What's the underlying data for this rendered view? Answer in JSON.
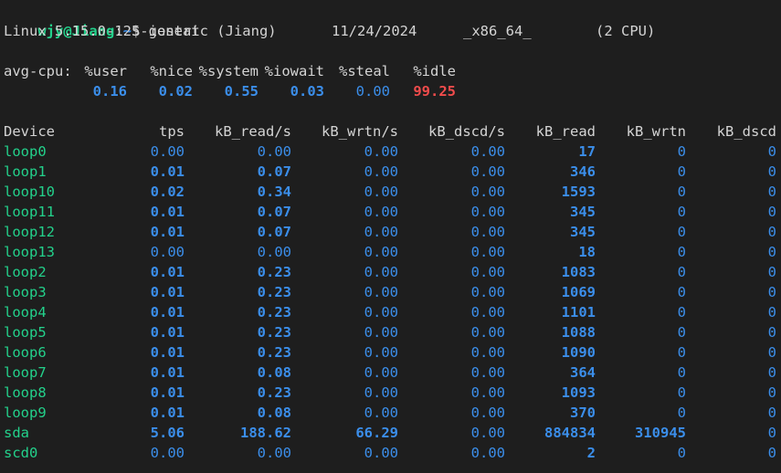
{
  "prompt": {
    "user_host": "wjy@Jiang",
    "path": "~",
    "symbol": "$",
    "command": "iostat"
  },
  "sysinfo": {
    "kernel": "Linux 5.15.0-125-generic (Jiang)",
    "date": "11/24/2024",
    "arch": "_x86_64_",
    "cpus": "(2 CPU)"
  },
  "cpu": {
    "label": "avg-cpu:",
    "headers": [
      "%user",
      "%nice",
      "%system",
      "%iowait",
      "%steal",
      "%idle"
    ],
    "values": [
      "0.16",
      "0.02",
      "0.55",
      "0.03",
      "0.00",
      "99.25"
    ]
  },
  "device_table": {
    "headers": [
      "Device",
      "tps",
      "kB_read/s",
      "kB_wrtn/s",
      "kB_dscd/s",
      "kB_read",
      "kB_wrtn",
      "kB_dscd"
    ],
    "rows": [
      [
        "loop0",
        "0.00",
        "0.00",
        "0.00",
        "0.00",
        "17",
        "0",
        "0"
      ],
      [
        "loop1",
        "0.01",
        "0.07",
        "0.00",
        "0.00",
        "346",
        "0",
        "0"
      ],
      [
        "loop10",
        "0.02",
        "0.34",
        "0.00",
        "0.00",
        "1593",
        "0",
        "0"
      ],
      [
        "loop11",
        "0.01",
        "0.07",
        "0.00",
        "0.00",
        "345",
        "0",
        "0"
      ],
      [
        "loop12",
        "0.01",
        "0.07",
        "0.00",
        "0.00",
        "345",
        "0",
        "0"
      ],
      [
        "loop13",
        "0.00",
        "0.00",
        "0.00",
        "0.00",
        "18",
        "0",
        "0"
      ],
      [
        "loop2",
        "0.01",
        "0.23",
        "0.00",
        "0.00",
        "1083",
        "0",
        "0"
      ],
      [
        "loop3",
        "0.01",
        "0.23",
        "0.00",
        "0.00",
        "1069",
        "0",
        "0"
      ],
      [
        "loop4",
        "0.01",
        "0.23",
        "0.00",
        "0.00",
        "1101",
        "0",
        "0"
      ],
      [
        "loop5",
        "0.01",
        "0.23",
        "0.00",
        "0.00",
        "1088",
        "0",
        "0"
      ],
      [
        "loop6",
        "0.01",
        "0.23",
        "0.00",
        "0.00",
        "1090",
        "0",
        "0"
      ],
      [
        "loop7",
        "0.01",
        "0.08",
        "0.00",
        "0.00",
        "364",
        "0",
        "0"
      ],
      [
        "loop8",
        "0.01",
        "0.23",
        "0.00",
        "0.00",
        "1093",
        "0",
        "0"
      ],
      [
        "loop9",
        "0.01",
        "0.08",
        "0.00",
        "0.00",
        "370",
        "0",
        "0"
      ],
      [
        "sda",
        "5.06",
        "188.62",
        "66.29",
        "0.00",
        "884834",
        "310945",
        "0"
      ],
      [
        "scd0",
        "0.00",
        "0.00",
        "0.00",
        "0.00",
        "2",
        "0",
        "0"
      ]
    ]
  },
  "colors": {
    "background": "#1e1e1e",
    "text": "#d4d4d4",
    "green": "#23d18b",
    "blue": "#3b8eea",
    "red": "#f14c4c"
  }
}
